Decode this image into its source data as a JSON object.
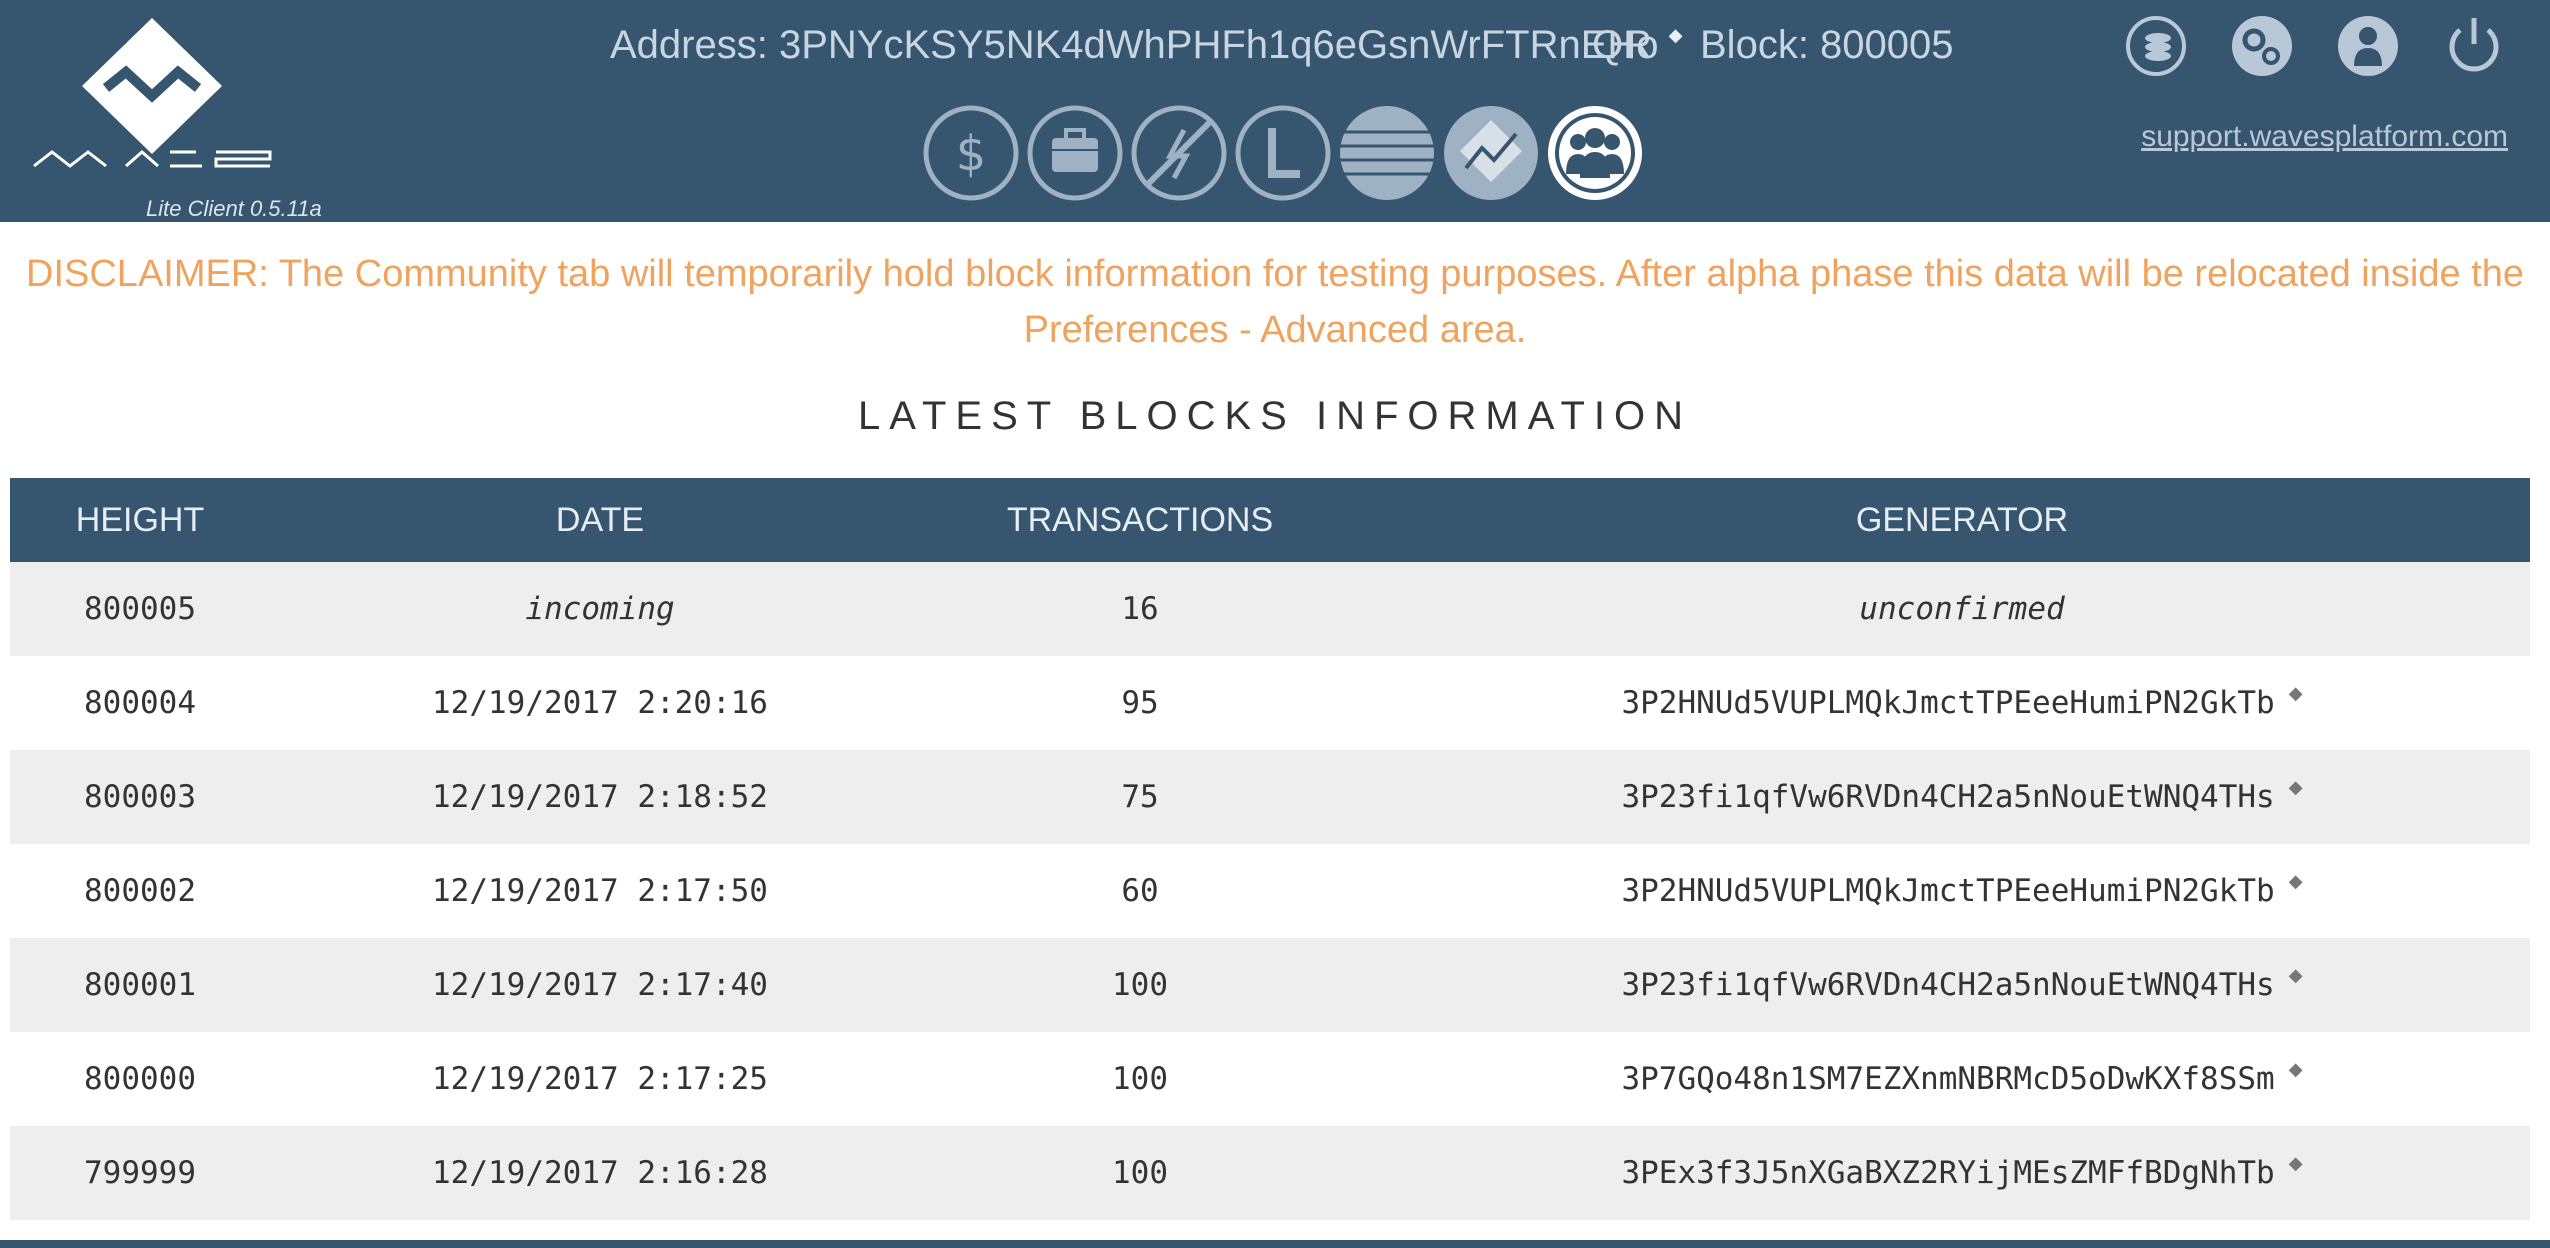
{
  "app": {
    "logo_sub": "Lite Client 0.5.11a"
  },
  "header": {
    "address_label": "Address: 3PNYcKSY5NK4dWhPHFh1q6eGsnWrFTRnEHo",
    "qr_label": "QR",
    "block_label": "Block: 800005",
    "support_link": "support.wavesplatform.com",
    "top_icons": [
      "leasing-coins-icon",
      "settings-gears-icon",
      "account-person-icon",
      "power-icon"
    ],
    "tabs": [
      "wallet-dollar",
      "portfolio-briefcase",
      "exchange-no",
      "leasing-L",
      "history-lines",
      "dex-chart",
      "community-people"
    ],
    "active_tab": "community-people"
  },
  "disclaimer": "DISCLAIMER: The Community tab will temporarily hold block information for testing purposes. After alpha phase this data will be relocated inside the Preferences - Advanced area.",
  "section_title": "LATEST BLOCKS INFORMATION",
  "table": {
    "headers": [
      "HEIGHT",
      "DATE",
      "TRANSACTIONS",
      "GENERATOR"
    ],
    "rows": [
      {
        "height": "800005",
        "date": "incoming",
        "transactions": "16",
        "generator": "unconfirmed"
      },
      {
        "height": "800004",
        "date": "12/19/2017 2:20:16",
        "transactions": "95",
        "generator": "3P2HNUd5VUPLMQkJmctTPEeeHumiPN2GkTb"
      },
      {
        "height": "800003",
        "date": "12/19/2017 2:18:52",
        "transactions": "75",
        "generator": "3P23fi1qfVw6RVDn4CH2a5nNouEtWNQ4THs"
      },
      {
        "height": "800002",
        "date": "12/19/2017 2:17:50",
        "transactions": "60",
        "generator": "3P2HNUd5VUPLMQkJmctTPEeeHumiPN2GkTb"
      },
      {
        "height": "800001",
        "date": "12/19/2017 2:17:40",
        "transactions": "100",
        "generator": "3P23fi1qfVw6RVDn4CH2a5nNouEtWNQ4THs"
      },
      {
        "height": "800000",
        "date": "12/19/2017 2:17:25",
        "transactions": "100",
        "generator": "3P7GQo48n1SM7EZXnmNBRMcD5oDwKXf8SSm"
      },
      {
        "height": "799999",
        "date": "12/19/2017 2:16:28",
        "transactions": "100",
        "generator": "3PEx3f3J5nXGaBXZ2RYijMEsZMFfBDgNhTb"
      }
    ]
  },
  "colors": {
    "header_bg": "#36556f",
    "disclaimer": "#f0a35e",
    "row_alt": "#eeeeee"
  }
}
